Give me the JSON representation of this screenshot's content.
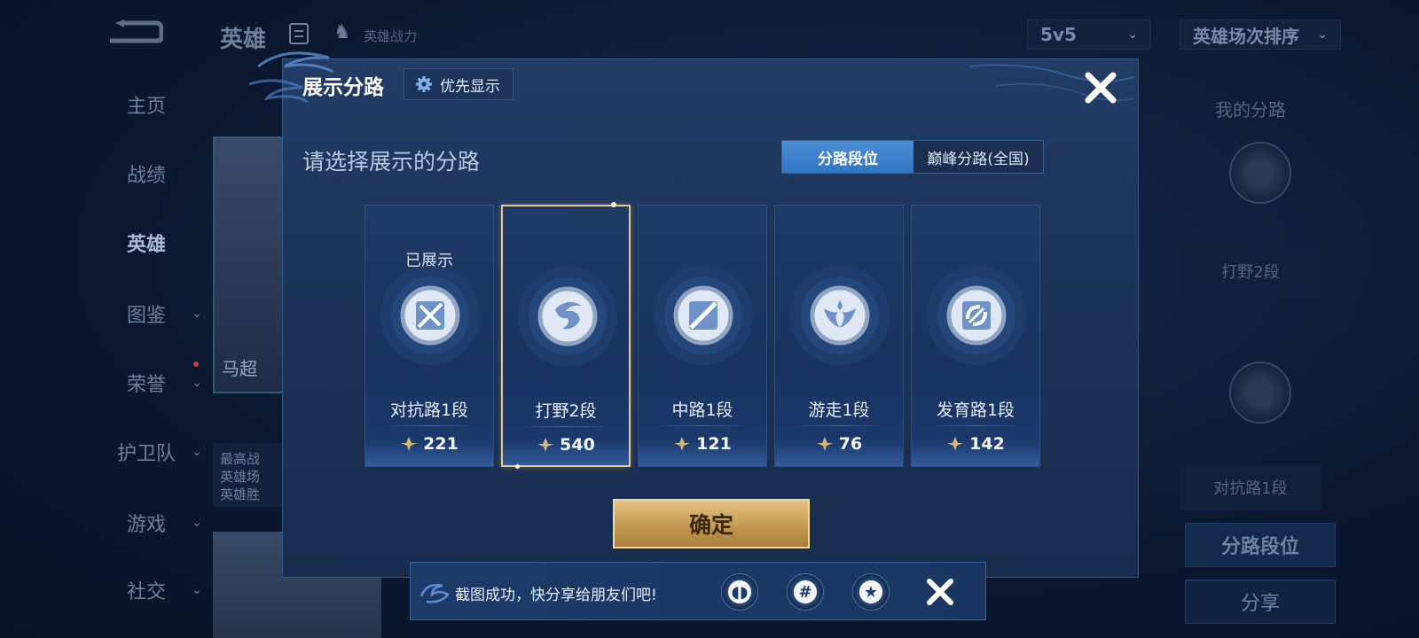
{
  "background": {
    "title": "英雄",
    "hero_power_label": "英雄战力",
    "mode_select": "5v5",
    "sort_select": "英雄场次排序",
    "nav": [
      {
        "label": "主页",
        "chevron": false
      },
      {
        "label": "战绩",
        "chevron": false
      },
      {
        "label": "英雄",
        "chevron": false
      },
      {
        "label": "图鉴",
        "chevron": true
      },
      {
        "label": "荣誉",
        "chevron": true
      },
      {
        "label": "护卫队",
        "chevron": true
      },
      {
        "label": "游戏",
        "chevron": true
      },
      {
        "label": "社交",
        "chevron": true
      }
    ],
    "hero_name": "马超",
    "hero_info": [
      "最高战",
      "英雄场",
      "英雄胜"
    ],
    "right_panel": {
      "title": "我的分路",
      "lane1": "打野2段",
      "lane2": "对抗路1段",
      "btn_lane_rank": "分路段位",
      "btn_share": "分享"
    }
  },
  "modal": {
    "title": "展示分路",
    "priority_label": "优先显示",
    "section_title": "请选择展示的分路",
    "tabs": [
      {
        "label": "分路段位",
        "active": true
      },
      {
        "label": "巅峰分路(全国)",
        "active": false
      }
    ],
    "lanes": [
      {
        "status": "已展示",
        "name": "对抗路1段",
        "score": "221",
        "icon": "sword-emblem-icon",
        "selected": false
      },
      {
        "status": "",
        "name": "打野2段",
        "score": "540",
        "icon": "jungle-dragon-emblem-icon",
        "selected": true
      },
      {
        "status": "",
        "name": "中路1段",
        "score": "121",
        "icon": "mid-lane-emblem-icon",
        "selected": false
      },
      {
        "status": "",
        "name": "游走1段",
        "score": "76",
        "icon": "wings-emblem-icon",
        "selected": false
      },
      {
        "status": "",
        "name": "发育路1段",
        "score": "142",
        "icon": "bow-emblem-icon",
        "selected": false
      }
    ],
    "confirm_label": "确定"
  },
  "toast": {
    "message": "截图成功，快分享给朋友们吧!",
    "share_targets": [
      "qq-penguin-icon",
      "wechat-moments-icon",
      "qzone-star-icon"
    ]
  },
  "colors": {
    "modal_bg": "#1c3358",
    "accent_blue": "#3f84cf",
    "gold": "#d2ad6a",
    "selected_border": "#e7c98f"
  }
}
